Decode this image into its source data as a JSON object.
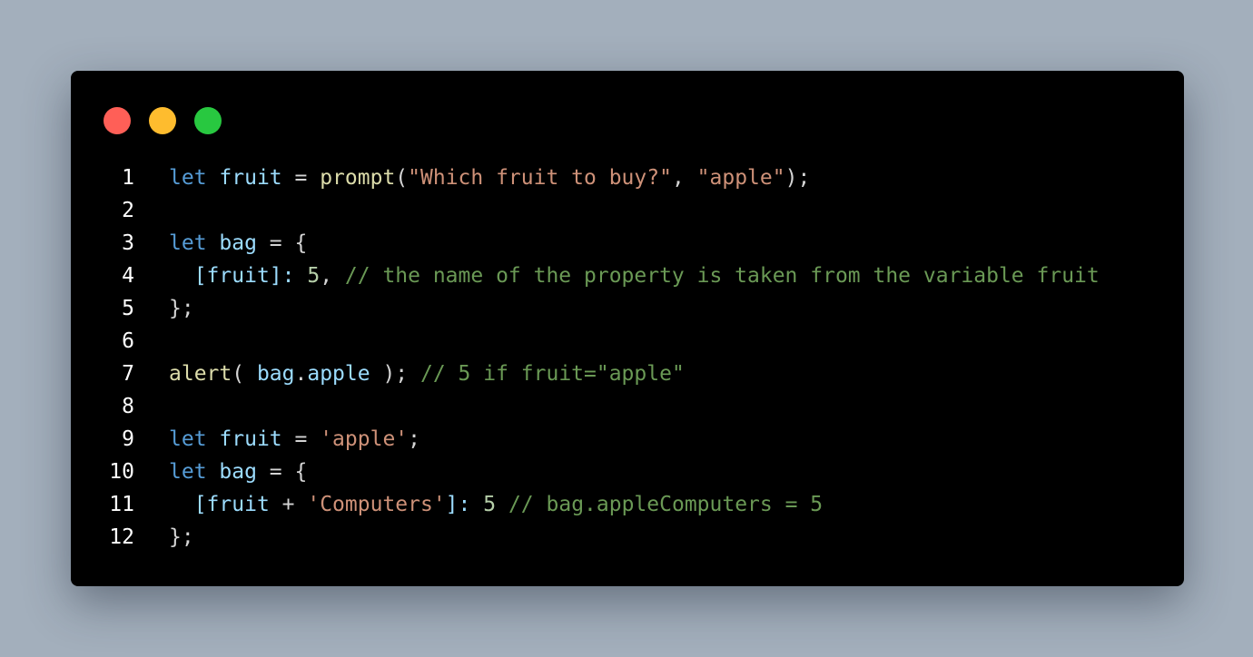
{
  "window": {
    "traffic_lights": [
      {
        "name": "close",
        "color": "#ff5f57"
      },
      {
        "name": "minimize",
        "color": "#febc2e"
      },
      {
        "name": "maximize",
        "color": "#28c840"
      }
    ]
  },
  "code": {
    "language": "javascript",
    "lines": [
      {
        "number": "1",
        "tokens": [
          {
            "t": "keyword",
            "v": "let"
          },
          {
            "t": "plain",
            "v": " "
          },
          {
            "t": "variable",
            "v": "fruit"
          },
          {
            "t": "plain",
            "v": " = "
          },
          {
            "t": "function",
            "v": "prompt"
          },
          {
            "t": "plain",
            "v": "("
          },
          {
            "t": "string",
            "v": "\"Which fruit to buy?\""
          },
          {
            "t": "plain",
            "v": ", "
          },
          {
            "t": "string",
            "v": "\"apple\""
          },
          {
            "t": "plain",
            "v": ");"
          }
        ]
      },
      {
        "number": "2",
        "tokens": []
      },
      {
        "number": "3",
        "tokens": [
          {
            "t": "keyword",
            "v": "let"
          },
          {
            "t": "plain",
            "v": " "
          },
          {
            "t": "variable",
            "v": "bag"
          },
          {
            "t": "plain",
            "v": " = {"
          }
        ]
      },
      {
        "number": "4",
        "tokens": [
          {
            "t": "plain",
            "v": "  "
          },
          {
            "t": "variable",
            "v": "[fruit]:"
          },
          {
            "t": "plain",
            "v": " "
          },
          {
            "t": "number",
            "v": "5"
          },
          {
            "t": "plain",
            "v": ", "
          },
          {
            "t": "comment",
            "v": "// the name of the property is taken from the variable fruit"
          }
        ]
      },
      {
        "number": "5",
        "tokens": [
          {
            "t": "plain",
            "v": "};"
          }
        ]
      },
      {
        "number": "6",
        "tokens": []
      },
      {
        "number": "7",
        "tokens": [
          {
            "t": "function",
            "v": "alert"
          },
          {
            "t": "plain",
            "v": "( "
          },
          {
            "t": "variable",
            "v": "bag"
          },
          {
            "t": "plain",
            "v": "."
          },
          {
            "t": "variable",
            "v": "apple"
          },
          {
            "t": "plain",
            "v": " ); "
          },
          {
            "t": "comment",
            "v": "// 5 if fruit=\"apple\""
          }
        ]
      },
      {
        "number": "8",
        "tokens": []
      },
      {
        "number": "9",
        "tokens": [
          {
            "t": "keyword",
            "v": "let"
          },
          {
            "t": "plain",
            "v": " "
          },
          {
            "t": "variable",
            "v": "fruit"
          },
          {
            "t": "plain",
            "v": " = "
          },
          {
            "t": "string",
            "v": "'apple'"
          },
          {
            "t": "plain",
            "v": ";"
          }
        ]
      },
      {
        "number": "10",
        "tokens": [
          {
            "t": "keyword",
            "v": "let"
          },
          {
            "t": "plain",
            "v": " "
          },
          {
            "t": "variable",
            "v": "bag"
          },
          {
            "t": "plain",
            "v": " = {"
          }
        ]
      },
      {
        "number": "11",
        "tokens": [
          {
            "t": "plain",
            "v": "  "
          },
          {
            "t": "variable",
            "v": "[fruit"
          },
          {
            "t": "plain",
            "v": " + "
          },
          {
            "t": "string",
            "v": "'Computers'"
          },
          {
            "t": "variable",
            "v": "]:"
          },
          {
            "t": "plain",
            "v": " "
          },
          {
            "t": "number",
            "v": "5"
          },
          {
            "t": "plain",
            "v": " "
          },
          {
            "t": "comment",
            "v": "// bag.appleComputers = 5"
          }
        ]
      },
      {
        "number": "12",
        "tokens": [
          {
            "t": "plain",
            "v": "};"
          }
        ]
      }
    ]
  }
}
